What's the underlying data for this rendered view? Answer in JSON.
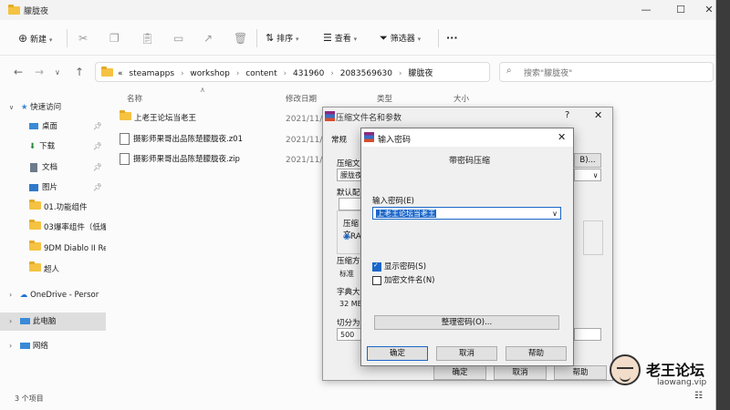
{
  "window": {
    "title": "朦胧夜"
  },
  "toolbar": {
    "new_label": "新建",
    "sort_label": "排序",
    "view_label": "查看",
    "filter_label": "筛选器",
    "more_label": "···"
  },
  "address": {
    "prefix": "«",
    "segments": [
      "steamapps",
      "workshop",
      "content",
      "431960",
      "2083569630",
      "朦胧夜"
    ],
    "separator": "›"
  },
  "search": {
    "placeholder": "搜索\"朦胧夜\""
  },
  "columns": {
    "name": "名称",
    "date": "修改日期",
    "type": "类型",
    "size": "大小"
  },
  "files": [
    {
      "name": "上老王论坛当老王",
      "date": "2021/11/",
      "kind": "folder"
    },
    {
      "name": "摄影师果哥出品陈楚朦胧夜.z01",
      "date": "2021/11/",
      "kind": "file"
    },
    {
      "name": "摄影师果哥出品陈楚朦胧夜.zip",
      "date": "2021/11/",
      "kind": "file"
    }
  ],
  "sidebar": {
    "quick_access": "快速访问",
    "items": [
      {
        "label": "桌面",
        "pinned": true
      },
      {
        "label": "下载",
        "pinned": true
      },
      {
        "label": "文档",
        "pinned": true
      },
      {
        "label": "图片",
        "pinned": true
      },
      {
        "label": "01.功能组件",
        "pinned": false
      },
      {
        "label": "03爆率组件（低爆",
        "pinned": false
      },
      {
        "label": "9DM Diablo II Re",
        "pinned": false
      },
      {
        "label": "超人",
        "pinned": false
      }
    ],
    "onedrive": "OneDrive - Persor",
    "this_pc": "此电脑",
    "network": "网络"
  },
  "status": {
    "count": "3 个项目"
  },
  "compress_dialog": {
    "title": "压缩文件名和参数",
    "help_glyph": "?",
    "tab_general": "常规",
    "archive_name_label": "压缩文",
    "archive_name_value": "朦胧夜",
    "default_label": "默认配",
    "format_label": "压缩文",
    "format_radio": "RA",
    "method_label": "压缩方",
    "method_value": "标准",
    "dict_label": "字典大",
    "dict_value": "32 MB",
    "split_label": "切分为",
    "split_value": "500",
    "browse_fragment": "B)...",
    "ok": "确定",
    "cancel": "取消",
    "help": "帮助"
  },
  "password_dialog": {
    "title": "输入密码",
    "heading": "带密码压缩",
    "enter_label": "输入密码(E)",
    "password_value": "上老王论坛当老王",
    "show_password": "显示密码(S)",
    "show_password_checked": true,
    "encrypt_names": "加密文件名(N)",
    "encrypt_names_checked": false,
    "organize": "整理密码(O)...",
    "ok": "确定",
    "cancel": "取消",
    "help": "帮助"
  },
  "watermark": {
    "brand": "老王论坛",
    "site": "laowang.vip"
  }
}
